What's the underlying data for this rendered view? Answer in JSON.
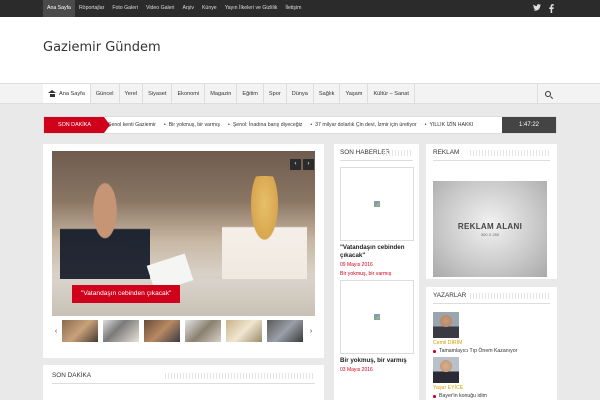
{
  "topnav": {
    "items": [
      "Ana Sayfa",
      "Röportajlar",
      "Foto Galeri",
      "Video Galeri",
      "Arşiv",
      "Künye",
      "Yayın İlkeleri ve Gizlilik",
      "İletişim"
    ],
    "social": [
      "twitter-icon",
      "facebook-icon"
    ]
  },
  "header": {
    "logo": "Gaziemir Gündem"
  },
  "mainnav": {
    "items": [
      "Ana Sayfa",
      "Güncel",
      "Yerel",
      "Siyaset",
      "Ekonomi",
      "Magazin",
      "Eğitim",
      "Spor",
      "Dünya",
      "Sağlık",
      "Yaşam",
      "Kültür – Sanat"
    ]
  },
  "ticker": {
    "label": "SON DAKİKA",
    "items": [
      "Şenol kenti Gaziemir",
      "Bir yokmuş, bir varmış",
      "Şenol: İnadına barış diyeceğiz",
      "37 milyar dolarlık Çin devi, İzmir için üretiyor",
      "YILLIK İZİN HAKKI"
    ],
    "time": "1:47:22"
  },
  "slider": {
    "caption": "\"Vatandaşın cebinden çıkacak\"",
    "prev": "‹",
    "next": "›"
  },
  "sondakika": {
    "title": "SON DAKİKA"
  },
  "news": {
    "title": "SON HABERLER",
    "items": [
      {
        "title": "\"Vatandaşın cebinden çıkacak\"",
        "date": "09 Mayıs 2016"
      },
      {
        "label": "Bir yokmuş, bir varmış",
        "title": "Bir yokmuş, bir varmış",
        "date": "03 Mayıs 2016"
      }
    ]
  },
  "reklam": {
    "title": "REKLAM",
    "ad_main": "REKLAM ALANI",
    "ad_sub": "300 X 250"
  },
  "authors": {
    "title": "YAZARLAR",
    "items": [
      {
        "name": "Cemil DİRİM",
        "post": "Tamamlayıcı Tıp Önem Kazanıyor"
      },
      {
        "name": "Yaşar EYİCE",
        "post": "Bayer'in konuğu idim"
      }
    ]
  },
  "colors": {
    "accent": "#d0021b",
    "topbar": "#2b2b2b",
    "background": "#e9e9e9"
  }
}
